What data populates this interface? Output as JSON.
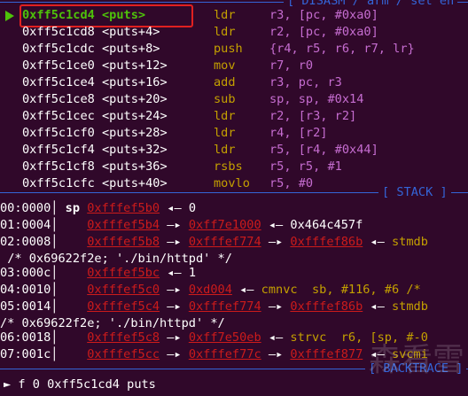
{
  "top_header": "[ DISASM / arm / set en",
  "disasm": [
    {
      "addr": "0xff5c1cd4",
      "sym": "<puts>",
      "op": "ldr",
      "args": "r3, [pc, #0xa0]",
      "current": true
    },
    {
      "addr": "0xff5c1cd8",
      "sym": "<puts+4>",
      "op": "ldr",
      "args": "r2, [pc, #0xa0]"
    },
    {
      "addr": "0xff5c1cdc",
      "sym": "<puts+8>",
      "op": "push",
      "args": "{r4, r5, r6, r7, lr}"
    },
    {
      "addr": "0xff5c1ce0",
      "sym": "<puts+12>",
      "op": "mov",
      "args": "r7, r0"
    },
    {
      "addr": "0xff5c1ce4",
      "sym": "<puts+16>",
      "op": "add",
      "args": "r3, pc, r3"
    },
    {
      "addr": "0xff5c1ce8",
      "sym": "<puts+20>",
      "op": "sub",
      "args": "sp, sp, #0x14"
    },
    {
      "addr": "0xff5c1cec",
      "sym": "<puts+24>",
      "op": "ldr",
      "args": "r2, [r3, r2]"
    },
    {
      "addr": "0xff5c1cf0",
      "sym": "<puts+28>",
      "op": "ldr",
      "args": "r4, [r2]"
    },
    {
      "addr": "0xff5c1cf4",
      "sym": "<puts+32>",
      "op": "ldr",
      "args": "r5, [r4, #0x44]"
    },
    {
      "addr": "0xff5c1cf8",
      "sym": "<puts+36>",
      "op": "rsbs",
      "args": "r5, r5, #1"
    },
    {
      "addr": "0xff5c1cfc",
      "sym": "<puts+40>",
      "op": "movlo",
      "args": "r5, #0"
    }
  ],
  "stack_header": "[ STACK ]",
  "stack": {
    "r0": {
      "idx": "00:0000",
      "reg": "sp",
      "a": "0xfffef5b0",
      "arrow": "◂—",
      "v": "0"
    },
    "r1": {
      "idx": "01:0004",
      "a": "0xfffef5b4",
      "b": "0xff7e1000",
      "v": "0x464c457f"
    },
    "r2": {
      "idx": "02:0008",
      "a": "0xfffef5b8",
      "b": "0xfffef774",
      "c": "0xfffef86b",
      "v": "stmdb"
    },
    "r2c": "/* 0x69622f2e; './bin/httpd' */",
    "r3": {
      "idx": "03:000c",
      "a": "0xfffef5bc",
      "v": "1"
    },
    "r4": {
      "idx": "04:0010",
      "a": "0xfffef5c0",
      "b": "0xd004",
      "v": "cmnvc  sb, #116, #6 /*"
    },
    "r5": {
      "idx": "05:0014",
      "a": "0xfffef5c4",
      "b": "0xfffef774",
      "c": "0xfffef86b",
      "v": "stmdb"
    },
    "r5c": "/* 0x69622f2e; './bin/httpd' */",
    "r6": {
      "idx": "06:0018",
      "a": "0xfffef5c8",
      "b": "0xff7e50eb",
      "v": "strvc  r6, [sp, #-0"
    },
    "r7": {
      "idx": "07:001c",
      "a": "0xfffef5cc",
      "b": "0xfffef77c",
      "c": "0xfffef877",
      "v": "svcmi"
    }
  },
  "backtrace_header": "[ BACKTRACE ]",
  "backtrace": "► f 0 0xff5c1cd4 puts",
  "arrow": "—▸"
}
